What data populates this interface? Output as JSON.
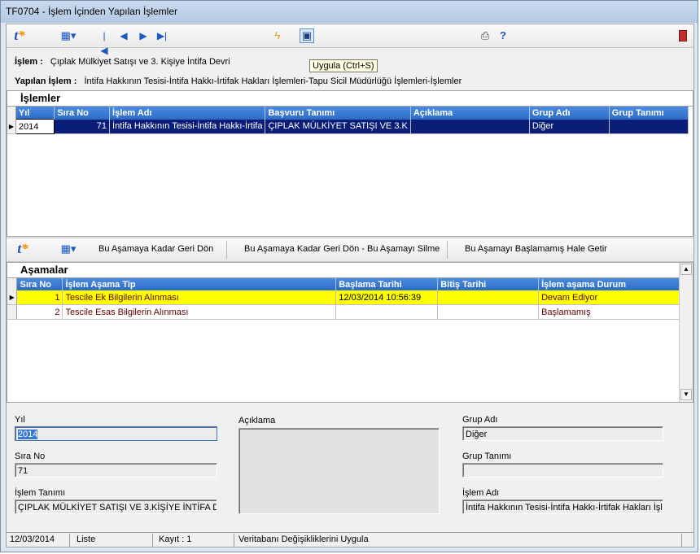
{
  "window": {
    "title": "TF0704 - İşlem İçinden Yapılan İşlemler"
  },
  "toolbar": {
    "tooltip": "Uygula (Ctrl+S)"
  },
  "info": {
    "islem_label": "İşlem :",
    "islem_value": "Çıplak Mülkiyet Satışı ve 3. Kişiye İntifa Devri",
    "yapilan_label": "Yapılan İşlem :",
    "yapilan_value": "İntifa Hakkının Tesisi-İntifa Hakkı-İrtifak Hakları İşlemleri-Tapu Sicil Müdürlüğü İşlemleri-İşlemler"
  },
  "islemler": {
    "title": "İşlemler",
    "columns": [
      "Yıl",
      "Sıra No",
      "İşlem Adı",
      "Başvuru Tanımı",
      "Açıklama",
      "Grup Adı",
      "Grup Tanımı"
    ],
    "rows": [
      [
        "2014",
        "71",
        "İntifa Hakkının Tesisi-İntifa Hakkı-İrtifa",
        "ÇIPLAK MÜLKİYET SATIŞI VE 3.K",
        "",
        "Diğer",
        ""
      ]
    ]
  },
  "toolbar2": {
    "btn1": "Bu Aşamaya Kadar Geri Dön",
    "btn2": "Bu Aşamaya Kadar Geri Dön - Bu Aşamayı Silme",
    "btn3": "Bu Aşamayı Başlamamış Hale Getir"
  },
  "asamalar": {
    "title": "Aşamalar",
    "columns": [
      "Sıra No",
      "İşlem Aşama Tip",
      "Başlama Tarihi",
      "Bitiş Tarihi",
      "İşlem aşama Durum"
    ],
    "rows": [
      [
        "1",
        "Tescile Ek Bilgilerin Alınması",
        "12/03/2014 10:56:39",
        "",
        "Devam Ediyor"
      ],
      [
        "2",
        "Tescile Esas Bilgilerin Alınması",
        "",
        "",
        "Başlamamış"
      ]
    ]
  },
  "form": {
    "yil_label": "Yıl",
    "yil_value": "2014",
    "sirano_label": "Sıra No",
    "sirano_value": "71",
    "islemtanimi_label": "İşlem Tanımı",
    "islemtanimi_value": "ÇIPLAK MÜLKİYET SATIŞI VE 3.KİŞİYE İNTİFA D",
    "aciklama_label": "Açıklama",
    "aciklama_value": "",
    "grupadi_label": "Grup Adı",
    "grupadi_value": "Diğer",
    "gruptanimi_label": "Grup Tanımı",
    "gruptanimi_value": "",
    "islemadi_label": "İşlem Adı",
    "islemadi_value": "İntifa Hakkının Tesisi-İntifa Hakkı-İrtifak Hakları İşler"
  },
  "status": {
    "date": "12/03/2014",
    "mode": "Liste",
    "kayit": "Kayıt : 1",
    "message": "Veritabanı Değişikliklerini Uygula"
  },
  "colors": {
    "grid_header": "#2d6cc6",
    "selected_row": "#0a1e78",
    "active_stage_row": "#ffff00"
  }
}
